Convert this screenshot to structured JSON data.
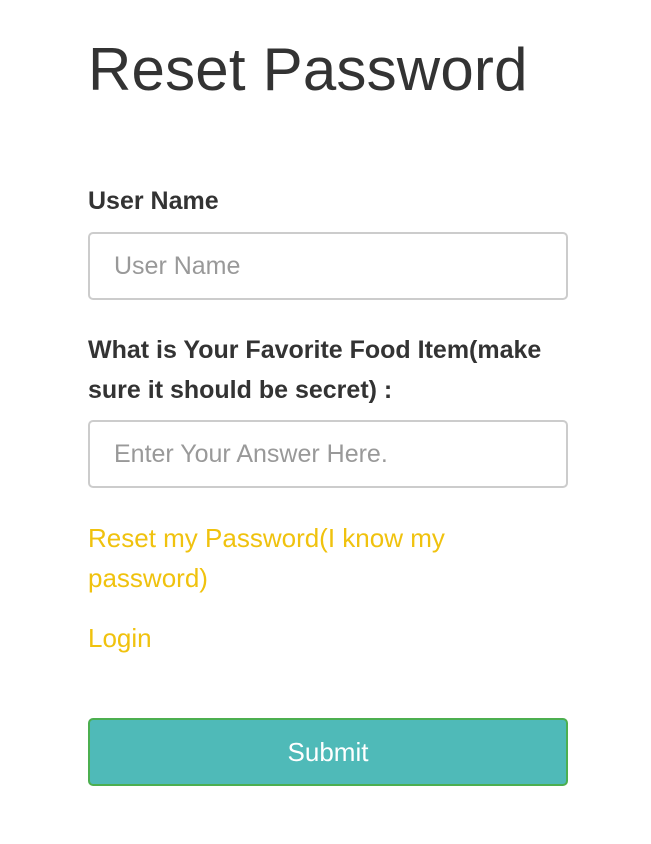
{
  "page": {
    "title": "Reset Password"
  },
  "form": {
    "username": {
      "label": "User Name",
      "placeholder": "User Name",
      "value": ""
    },
    "security_question": {
      "label": "What is Your Favorite Food Item(make sure it should be secret) :",
      "placeholder": "Enter Your Answer Here.",
      "value": ""
    },
    "submit_label": "Submit"
  },
  "links": {
    "reset_known": "Reset my Password(I know my password)",
    "login": "Login"
  },
  "colors": {
    "link": "#f0c20e",
    "button_bg": "#4fbab8",
    "button_border": "#4caf50",
    "text": "#333333"
  }
}
